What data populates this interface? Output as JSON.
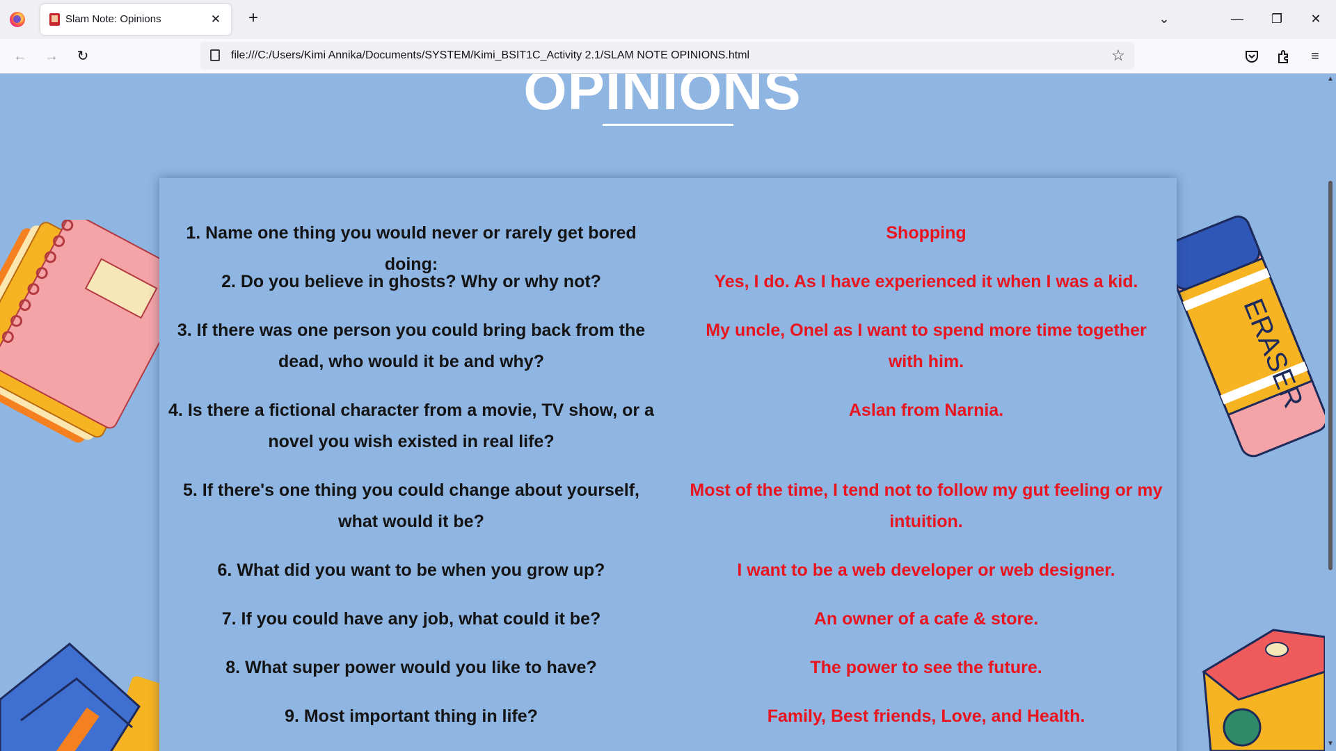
{
  "browser": {
    "tab_title": "Slam Note: Opinions",
    "url": "file:///C:/Users/Kimi Annika/Documents/SYSTEM/Kimi_BSIT1C_Activity 2.1/SLAM NOTE OPINIONS.html",
    "icons": [
      "firefox-logo",
      "close-icon",
      "plus-icon",
      "chevron-down-icon",
      "minimize-icon",
      "restore-icon",
      "window-close-icon",
      "back-icon",
      "forward-icon",
      "reload-icon",
      "page-icon",
      "star-icon",
      "pocket-icon",
      "extensions-icon",
      "menu-icon"
    ]
  },
  "page": {
    "heading": "OPINIONS",
    "background_color": "#8fb5e2",
    "answer_color": "#e8141e",
    "items": [
      {
        "question": "1. Name one thing you would never or rarely get bored doing:",
        "answer": "Shopping"
      },
      {
        "question": "2. Do you believe in ghosts? Why or why not?",
        "answer": "Yes, I do. As I have experienced it when I was a kid."
      },
      {
        "question": "3. If there was one person you could bring back from the dead, who would it be and why?",
        "answer": "My uncle, Onel as I want to spend more time together with him."
      },
      {
        "question": "4. Is there a fictional character from a movie, TV show, or a novel you wish existed in real life?",
        "answer": "Aslan from Narnia."
      },
      {
        "question": "5. If there's one thing you could change about yourself, what would it be?",
        "answer": "Most of the time, I tend not to follow my gut feeling or my intuition."
      },
      {
        "question": "6. What did you want to be when you grow up?",
        "answer": "I want to be a web developer or web designer."
      },
      {
        "question": "7. If you could have any job, what could it be?",
        "answer": "An owner of a cafe & store."
      },
      {
        "question": "8. What super power would you like to have?",
        "answer": "The power to see the future."
      },
      {
        "question": "9. Most important thing in life?",
        "answer": "Family, Best friends, Love, and Health."
      }
    ],
    "decorations": [
      "notebook",
      "eraser",
      "pencil-case",
      "sharpener"
    ],
    "eraser_text": "ERASER"
  }
}
